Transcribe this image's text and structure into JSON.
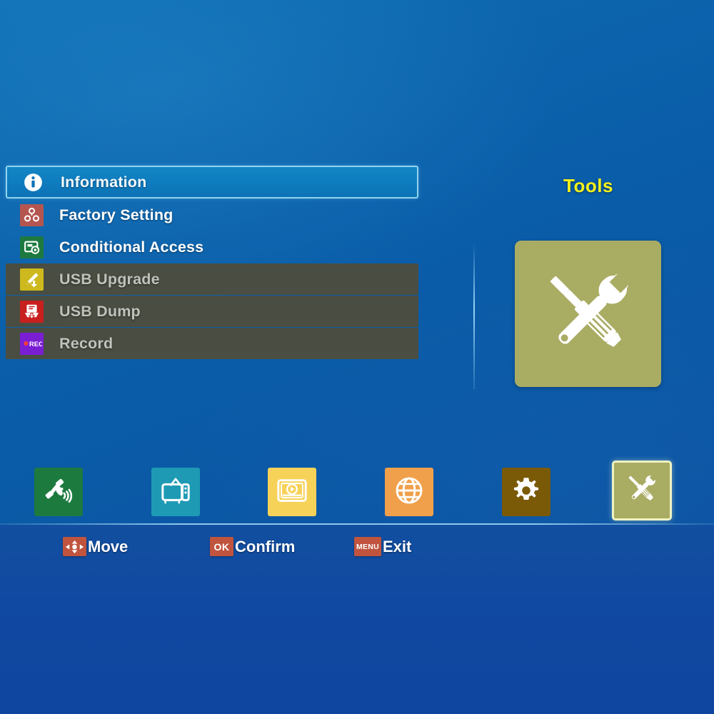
{
  "screen": {
    "background_color": "#0a5ca8",
    "accent_color": "#f6f21a"
  },
  "menu": {
    "items": [
      {
        "label": "Information",
        "icon": "info-icon",
        "state": "selected",
        "icon_bg": "transparent"
      },
      {
        "label": "Factory Setting",
        "icon": "factory-setting-icon",
        "state": "normal",
        "icon_bg": "#b4564f"
      },
      {
        "label": "Conditional Access",
        "icon": "smart-card-icon",
        "state": "normal",
        "icon_bg": "#1d7a3f"
      },
      {
        "label": "USB Upgrade",
        "icon": "usb-upgrade-icon",
        "state": "disabled",
        "icon_bg": "#cdb91e"
      },
      {
        "label": "USB Dump",
        "icon": "usb-dump-icon",
        "state": "disabled",
        "icon_bg": "#c81f1f"
      },
      {
        "label": "Record",
        "icon": "record-icon",
        "state": "disabled",
        "icon_bg": "#7a1ed4"
      }
    ]
  },
  "tools_panel": {
    "title": "Tools",
    "title_color": "#f6f21a",
    "icon": "wrench-screwdriver-icon",
    "icon_bg": "#a9ac63"
  },
  "categories": [
    {
      "name": "satellite-category",
      "icon": "satellite-dish-icon",
      "color": "#1d7a3f",
      "active": false
    },
    {
      "name": "tv-category",
      "icon": "television-icon",
      "color": "#1e9ab5",
      "active": false
    },
    {
      "name": "media-category",
      "icon": "media-player-icon",
      "color": "#f7d259",
      "active": false
    },
    {
      "name": "network-category",
      "icon": "globe-icon",
      "color": "#f0a04b",
      "active": false
    },
    {
      "name": "settings-category",
      "icon": "gear-icon",
      "color": "#7a5a06",
      "active": false
    },
    {
      "name": "tools-category",
      "icon": "wrench-screwdriver-icon",
      "color": "#a9ac63",
      "active": true
    }
  ],
  "help_bar": {
    "hints": [
      {
        "badge": "",
        "badge_icon": "dpad-icon",
        "label": "Move"
      },
      {
        "badge": "OK",
        "badge_icon": "",
        "label": "Confirm"
      },
      {
        "badge": "MENU",
        "badge_icon": "",
        "label": "Exit"
      }
    ],
    "badge_color": "#c0543f"
  }
}
